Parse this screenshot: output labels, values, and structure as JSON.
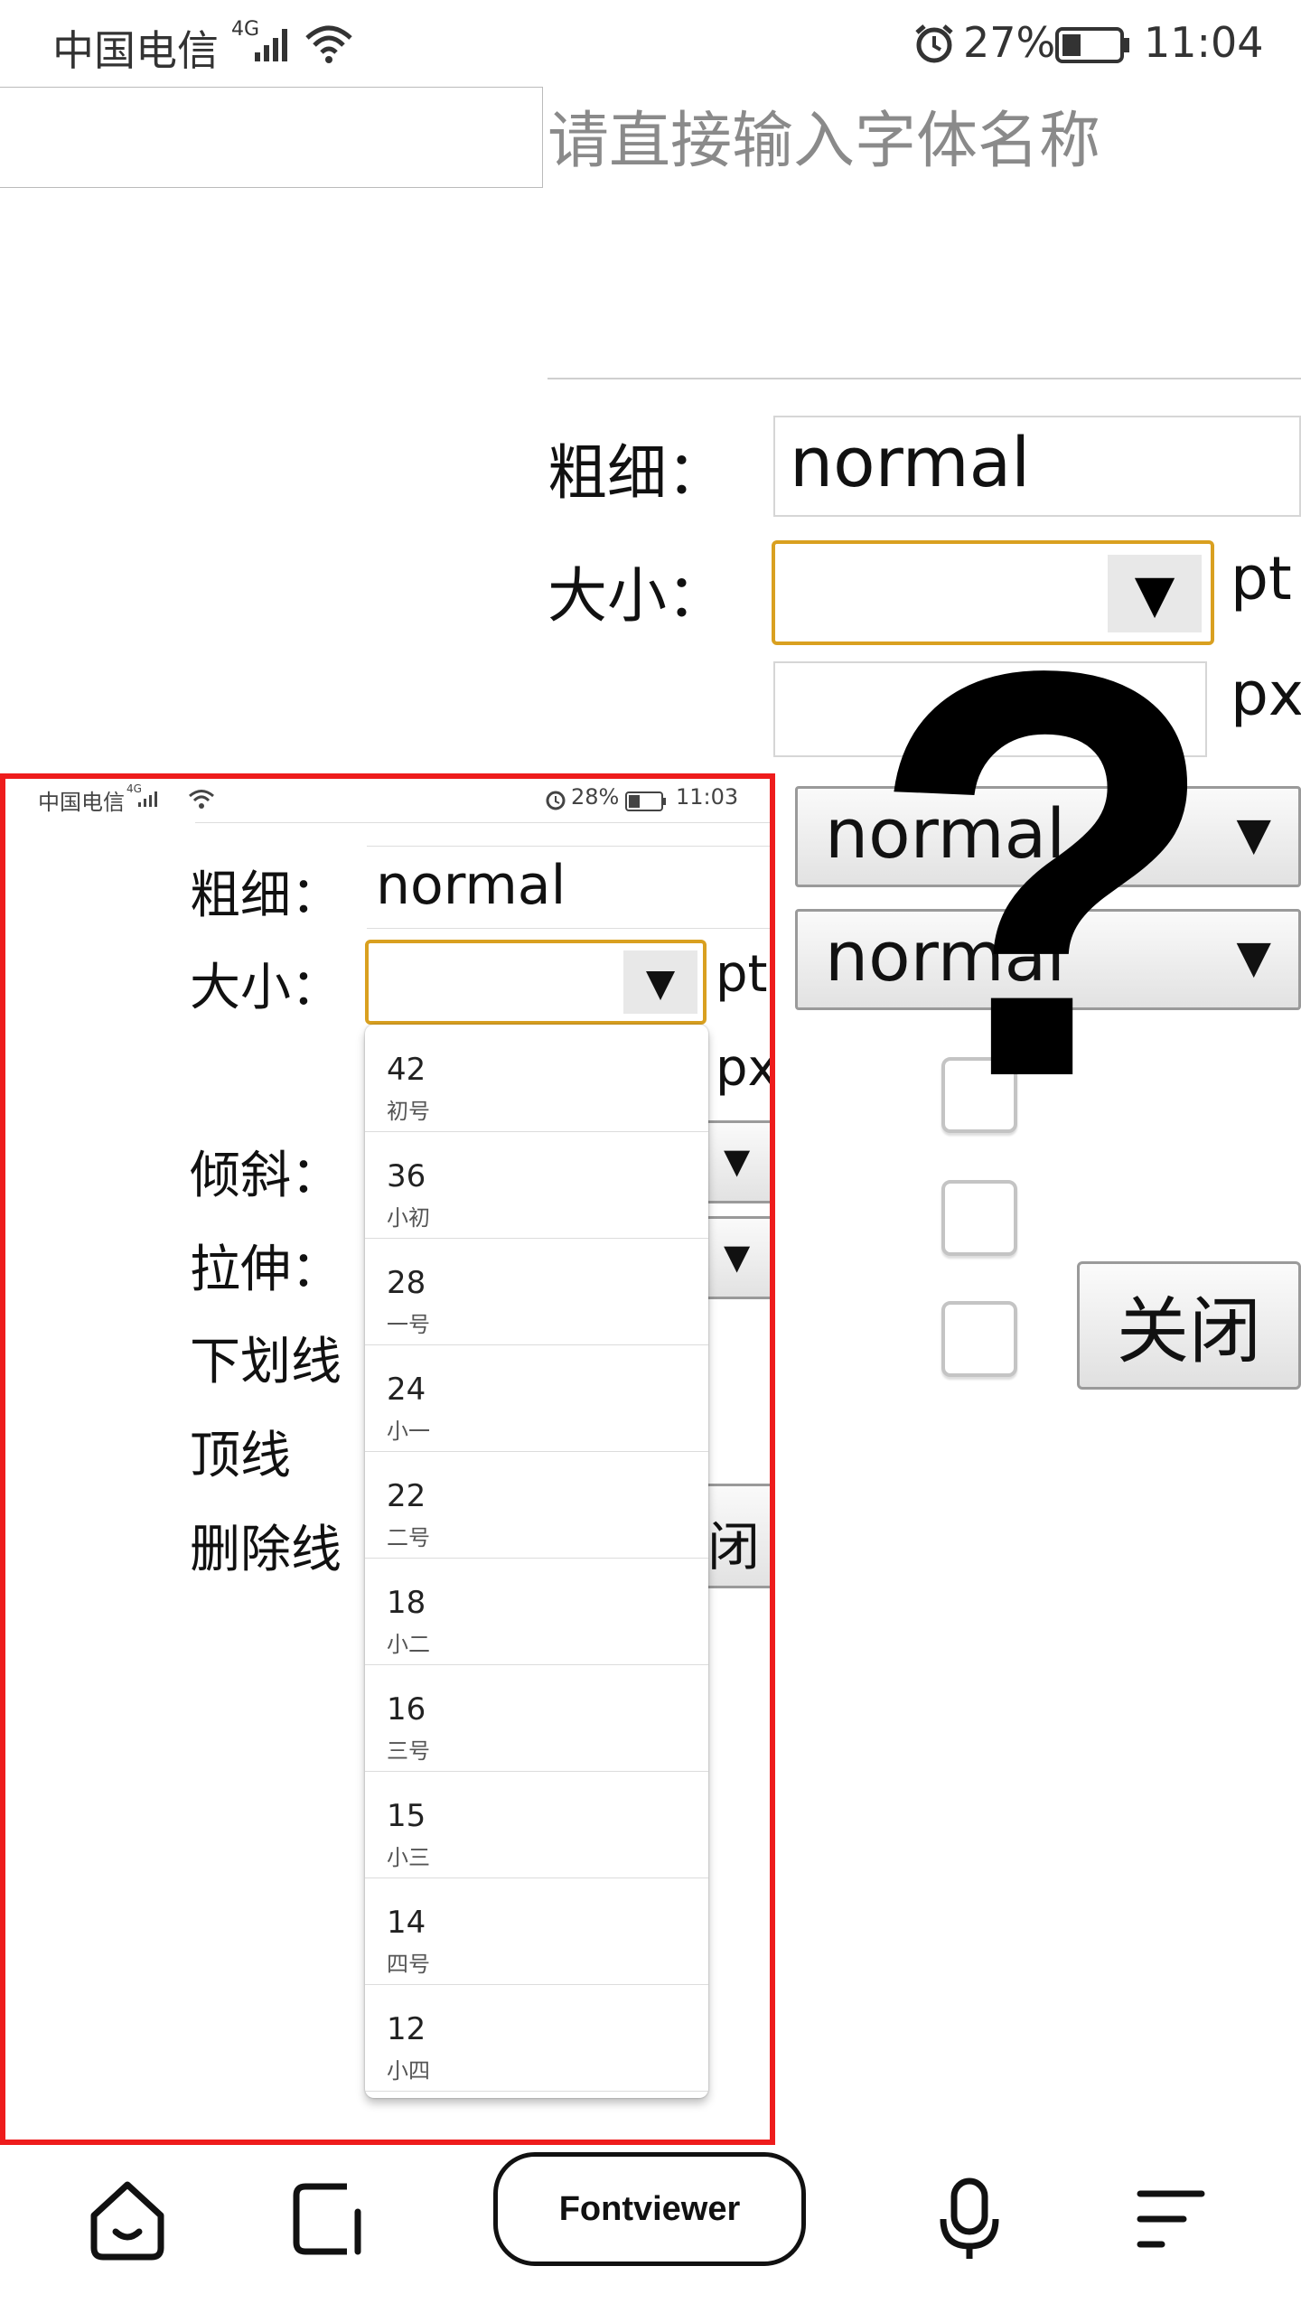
{
  "status_bar": {
    "carrier": "中国电信",
    "network": "4G",
    "battery": "27%",
    "time": "11:04"
  },
  "form": {
    "font_name_placeholder": "请直接输入字体名称",
    "weight_label": "粗细：",
    "weight_value": "normal",
    "size_label": "大小：",
    "size_value": "",
    "unit_pt": "pt",
    "unit_px": "px",
    "style_select": "normal",
    "stretch_select": "normal",
    "close_button": "关闭",
    "overlay_symbol": "?"
  },
  "inset": {
    "status_bar": {
      "carrier": "中国电信",
      "network": "4G",
      "battery": "28%",
      "time": "11:03"
    },
    "weight_label": "粗细：",
    "weight_value": "normal",
    "size_label": "大小：",
    "unit_pt": "pt",
    "unit_px": "px",
    "labels": [
      "倾斜：",
      "拉伸：",
      "下划线",
      "顶线",
      "删除线"
    ],
    "close_partial": "闭",
    "size_options": [
      {
        "value": "42",
        "name": "初号"
      },
      {
        "value": "36",
        "name": "小初"
      },
      {
        "value": "28",
        "name": "一号"
      },
      {
        "value": "24",
        "name": "小一"
      },
      {
        "value": "22",
        "name": "二号"
      },
      {
        "value": "18",
        "name": "小二"
      },
      {
        "value": "16",
        "name": "三号"
      },
      {
        "value": "15",
        "name": "小三"
      },
      {
        "value": "14",
        "name": "四号"
      },
      {
        "value": "12",
        "name": "小四"
      }
    ]
  },
  "bottom_nav": {
    "items": [
      {
        "icon": "home-icon"
      },
      {
        "icon": "tabs-icon"
      },
      {
        "label": "Fontviewer"
      },
      {
        "icon": "microphone-icon"
      },
      {
        "icon": "menu-icon"
      }
    ]
  },
  "colors": {
    "focus_border": "#d9a020",
    "inset_border": "#ee1c1c"
  }
}
